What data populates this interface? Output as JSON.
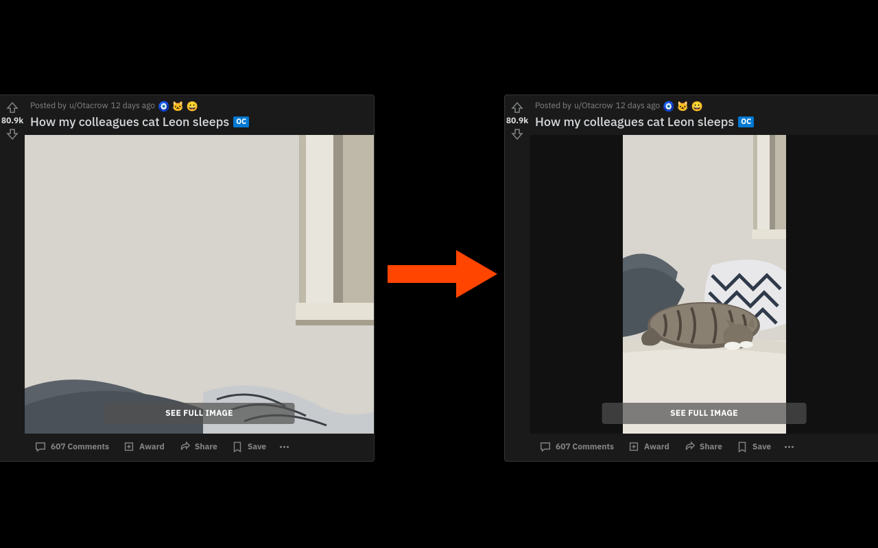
{
  "post": {
    "posted_by_prefix": "Posted by",
    "author": "u/Otacrow",
    "age": "12 days ago",
    "award_glyphs": "🧿 🐱 😀",
    "title": "How my colleagues cat Leon sleeps",
    "oc_label": "OC",
    "score": "80.9k",
    "see_full_label": "SEE FULL IMAGE",
    "actions": {
      "comments": "607 Comments",
      "award": "Award",
      "share": "Share",
      "save": "Save"
    }
  },
  "diagram": {
    "arrow_color": "#ff4500"
  }
}
